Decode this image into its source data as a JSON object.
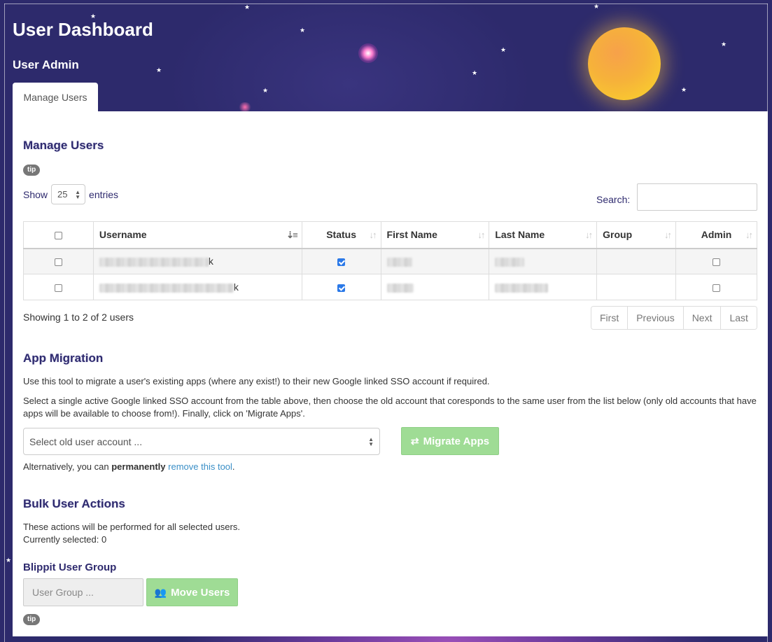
{
  "header": {
    "title": "User Dashboard",
    "subtitle": "User Admin",
    "tab_label": "Manage Users"
  },
  "manage_users": {
    "title": "Manage Users",
    "tip_label": "tip",
    "show_label": "Show",
    "entries_value": "25",
    "entries_label": "entries",
    "search_label": "Search:",
    "search_value": "",
    "columns": [
      "Username",
      "Status",
      "First Name",
      "Last Name",
      "Group",
      "Admin"
    ],
    "rows": [
      {
        "username_suffix": "k",
        "status_checked": true,
        "admin_checked": false,
        "selected": false
      },
      {
        "username_suffix": "k",
        "status_checked": true,
        "admin_checked": false,
        "selected": false
      }
    ],
    "showing_text": "Showing 1 to 2 of 2 users",
    "pager": [
      "First",
      "Previous",
      "Next",
      "Last"
    ]
  },
  "app_migration": {
    "title": "App Migration",
    "desc1": "Use this tool to migrate a user's existing apps (where any exist!) to their new Google linked SSO account if required.",
    "desc2": "Select a single active Google linked SSO account from the table above, then choose the old account that coresponds to the same user from the list below (only old accounts that have apps will be available to choose from!). Finally, click on 'Migrate Apps'.",
    "select_placeholder": "Select old user account ...",
    "migrate_button": "Migrate Apps",
    "alt_prefix": "Alternatively, you can ",
    "alt_bold": "permanently",
    "alt_link": "remove this tool",
    "alt_suffix": "."
  },
  "bulk_actions": {
    "title": "Bulk User Actions",
    "desc": "These actions will be performed for all selected users.",
    "selected_label": "Currently selected: 0",
    "group_title": "Blippit User Group",
    "group_placeholder": "User Group ...",
    "move_button": "Move Users",
    "tip_label": "tip"
  },
  "colors": {
    "sky": "#2d2a6c",
    "accent": "#2e2a6e",
    "button_green": "#9fdc95",
    "link": "#3a8fc7",
    "moon": "#f6b23a"
  }
}
